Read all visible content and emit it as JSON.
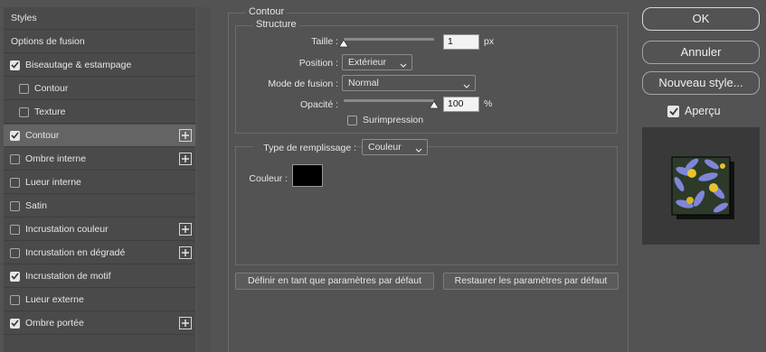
{
  "sidebar": {
    "items": [
      {
        "label": "Styles",
        "type": "header",
        "checked": null,
        "plus": false,
        "selected": false
      },
      {
        "label": "Options de fusion",
        "type": "header",
        "checked": null,
        "plus": false,
        "selected": false
      },
      {
        "label": "Biseautage & estampage",
        "type": "check",
        "checked": true,
        "plus": false,
        "selected": false
      },
      {
        "label": "Contour",
        "type": "sub",
        "checked": false,
        "plus": false,
        "selected": false
      },
      {
        "label": "Texture",
        "type": "sub",
        "checked": false,
        "plus": false,
        "selected": false
      },
      {
        "label": "Contour",
        "type": "check",
        "checked": true,
        "plus": true,
        "selected": true
      },
      {
        "label": "Ombre interne",
        "type": "check",
        "checked": false,
        "plus": true,
        "selected": false
      },
      {
        "label": "Lueur interne",
        "type": "check",
        "checked": false,
        "plus": false,
        "selected": false
      },
      {
        "label": "Satin",
        "type": "check",
        "checked": false,
        "plus": false,
        "selected": false
      },
      {
        "label": "Incrustation couleur",
        "type": "check",
        "checked": false,
        "plus": true,
        "selected": false
      },
      {
        "label": "Incrustation en dégradé",
        "type": "check",
        "checked": false,
        "plus": true,
        "selected": false
      },
      {
        "label": "Incrustation de motif",
        "type": "check",
        "checked": true,
        "plus": false,
        "selected": false
      },
      {
        "label": "Lueur externe",
        "type": "check",
        "checked": false,
        "plus": false,
        "selected": false
      },
      {
        "label": "Ombre portée",
        "type": "check",
        "checked": true,
        "plus": true,
        "selected": false
      }
    ]
  },
  "panel": {
    "title": "Contour",
    "structure": {
      "title": "Structure",
      "size_label": "Taille :",
      "size_value": "1",
      "size_unit": "px",
      "size_fraction": 0.0,
      "position_label": "Position :",
      "position_value": "Extérieur",
      "blend_label": "Mode de fusion :",
      "blend_value": "Normal",
      "opacity_label": "Opacité :",
      "opacity_value": "100",
      "opacity_unit": "%",
      "opacity_fraction": 1.0,
      "overprint_label": "Surimpression",
      "overprint_checked": false
    },
    "fill": {
      "type_label": "Type de remplissage :",
      "type_value": "Couleur",
      "color_label": "Couleur :",
      "color_value": "#000000"
    },
    "set_default_label": "Définir en tant que paramètres par défaut",
    "reset_default_label": "Restaurer les paramètres par défaut"
  },
  "actions": {
    "ok_label": "OK",
    "cancel_label": "Annuler",
    "new_style_label": "Nouveau style...",
    "preview_label": "Aperçu",
    "preview_checked": true
  },
  "colors": {
    "dialog_bg": "#535353",
    "selected_row": "#646464",
    "list_bg": "#4a4a4a"
  }
}
